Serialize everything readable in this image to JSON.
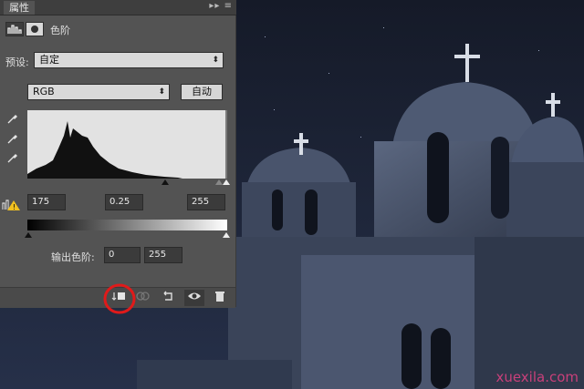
{
  "panel": {
    "tab_label": "属性",
    "tab_menu": "▸▸ ≡",
    "title": "色阶",
    "preset_label": "预设:",
    "preset_value": "自定",
    "channel_value": "RGB",
    "auto_button": "自动",
    "input_levels": {
      "black": "175",
      "mid": "0.25",
      "white": "255"
    },
    "output_label": "输出色阶:",
    "output_levels": {
      "black": "0",
      "white": "255"
    }
  },
  "footer_icons": [
    "clip-to-layer-icon",
    "visibility-preview-icon",
    "reset-icon",
    "eye-icon",
    "trash-icon"
  ],
  "watermark": "xuexila.com",
  "colors": {
    "panel_bg": "#535353",
    "highlight_ring": "#e01a1a",
    "sky": "#1b2233",
    "watermark": "#c8407a"
  }
}
